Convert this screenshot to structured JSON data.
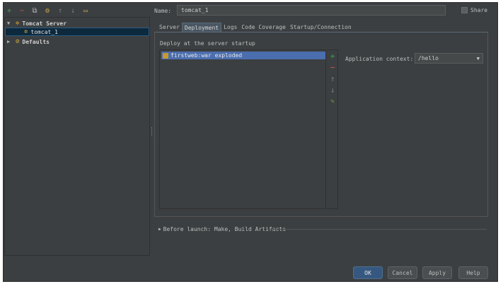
{
  "toolbar": {
    "icons": [
      "plus-icon",
      "minus-icon",
      "copy-icon",
      "edit-defaults-icon",
      "move-up-icon",
      "move-down-icon",
      "folder-icon"
    ]
  },
  "tree": {
    "group_label": "Tomcat Server",
    "item_label": "tomcat_1",
    "defaults_label": "Defaults"
  },
  "form": {
    "name_label": "Name:",
    "name_value": "tomcat_1",
    "share_label": "Share"
  },
  "tabs": [
    {
      "label": "Server"
    },
    {
      "label": "Deployment"
    },
    {
      "label": "Logs"
    },
    {
      "label": "Code Coverage"
    },
    {
      "label": "Startup/Connection"
    }
  ],
  "deployment": {
    "list_label": "Deploy at the server startup",
    "items": [
      {
        "label": "firstweb:war exploded"
      }
    ],
    "context_label": "Application context:",
    "context_value": "/hello"
  },
  "before_launch": {
    "label": "Before launch: Make, Build Artifacts"
  },
  "buttons": {
    "ok": "OK",
    "cancel": "Cancel",
    "apply": "Apply",
    "help": "Help"
  },
  "colors": {
    "background": "#3c3f41",
    "selection": "#4b6eaf",
    "add_green": "#499c54",
    "remove_red": "#c75450",
    "primary_button": "#365880"
  }
}
